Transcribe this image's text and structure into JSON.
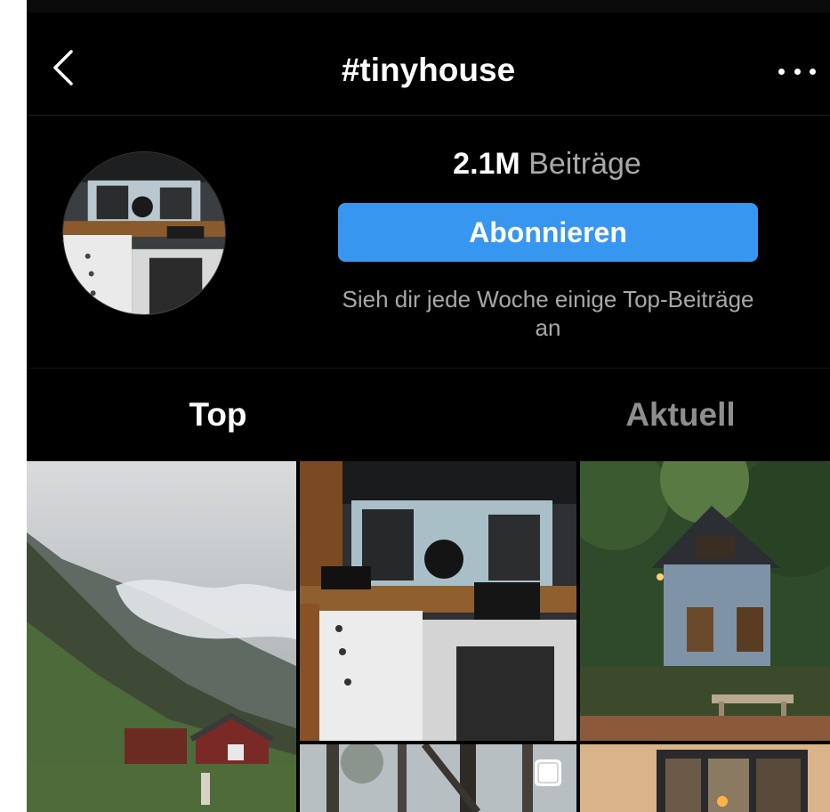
{
  "header": {
    "title": "#tinyhouse",
    "back_icon": "chevron-left-icon",
    "more_icon": "more-horizontal-icon"
  },
  "hashtag": {
    "post_count": "2.1M",
    "post_count_label": "Beiträge",
    "follow_label": "Abonnieren",
    "follow_hint": "Sieh dir jede Woche einige Top-Beiträge an"
  },
  "tabs": [
    {
      "label": "Top",
      "active": true
    },
    {
      "label": "Aktuell",
      "active": false
    }
  ],
  "colors": {
    "background": "#000000",
    "accent": "#3797f0",
    "secondary_text": "#a8a8a8",
    "inactive_tab": "#8e8e8e"
  },
  "grid": {
    "tiles": [
      {
        "subject": "mountain-cabin"
      },
      {
        "subject": "van-interior"
      },
      {
        "subject": "blue-forest-cabin"
      },
      {
        "subject": "forest-trees",
        "icon": "multiple-posts-icon"
      },
      {
        "subject": "glass-tiny-house"
      }
    ]
  }
}
